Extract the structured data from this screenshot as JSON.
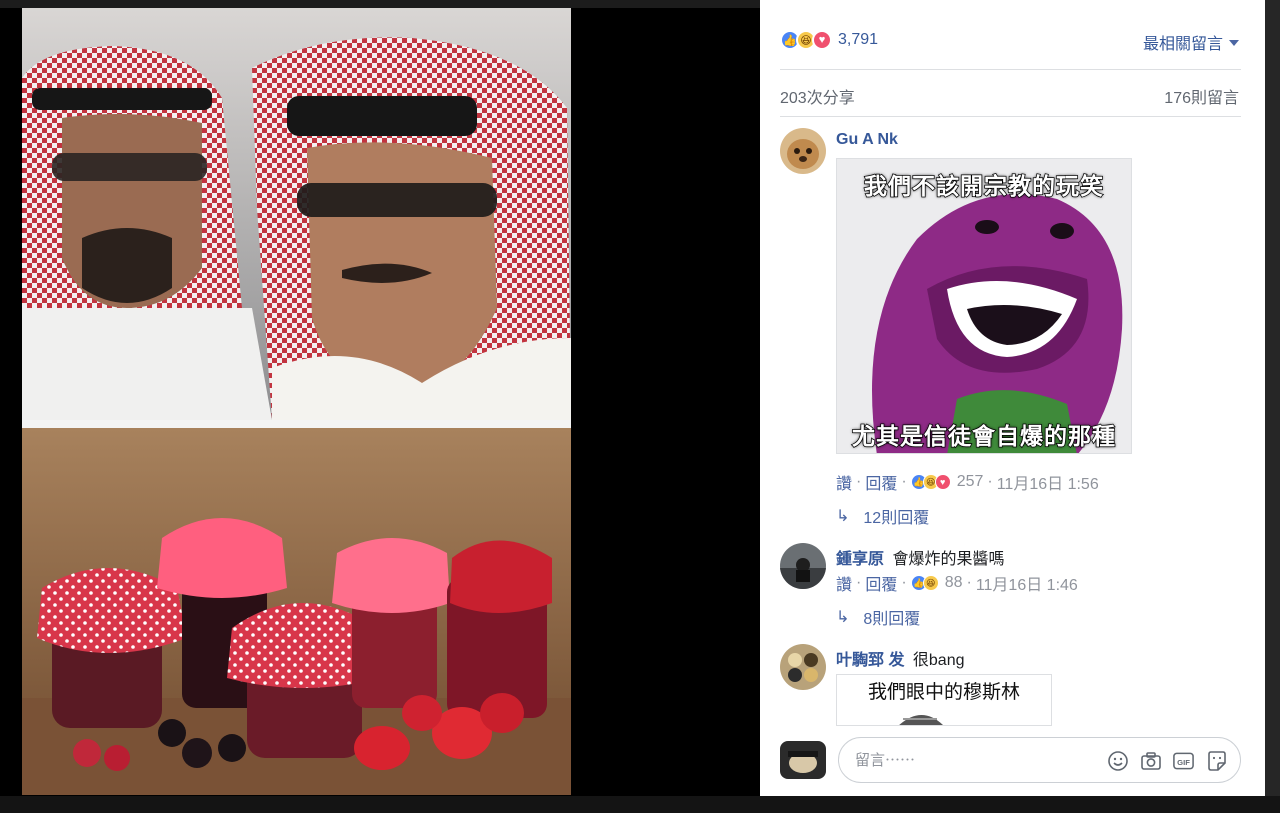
{
  "header": {
    "reaction_count": "3,791",
    "sort_label": "最相關留言",
    "shares": "203次分享",
    "comments_total": "176則留言"
  },
  "reactions": [
    "like",
    "haha",
    "love"
  ],
  "comments": [
    {
      "author": "Gu A Nk",
      "text": "",
      "image_top_text": "我們不該開宗教的玩笑",
      "image_bottom_text": "尤其是信徒會自爆的那種",
      "like": "讚",
      "reply": "回覆",
      "reaction_count": "257",
      "time": "11月16日 1:56",
      "replies": "12則回覆"
    },
    {
      "author": "鍾享原",
      "text": "會爆炸的果醬嗎",
      "like": "讚",
      "reply": "回覆",
      "reaction_count": "88",
      "time": "11月16日 1:46",
      "replies": "8則回覆"
    },
    {
      "author": "叶騊郅 发",
      "text": "很bang",
      "image_text": "我們眼中的穆斯林"
    }
  ],
  "composer": {
    "placeholder": "留言⋯⋯"
  },
  "colors": {
    "link": "#365899",
    "meta": "#90949c",
    "like_blue": "#4a85f5",
    "haha_yellow": "#f7c94b",
    "love_red": "#f0506e"
  }
}
